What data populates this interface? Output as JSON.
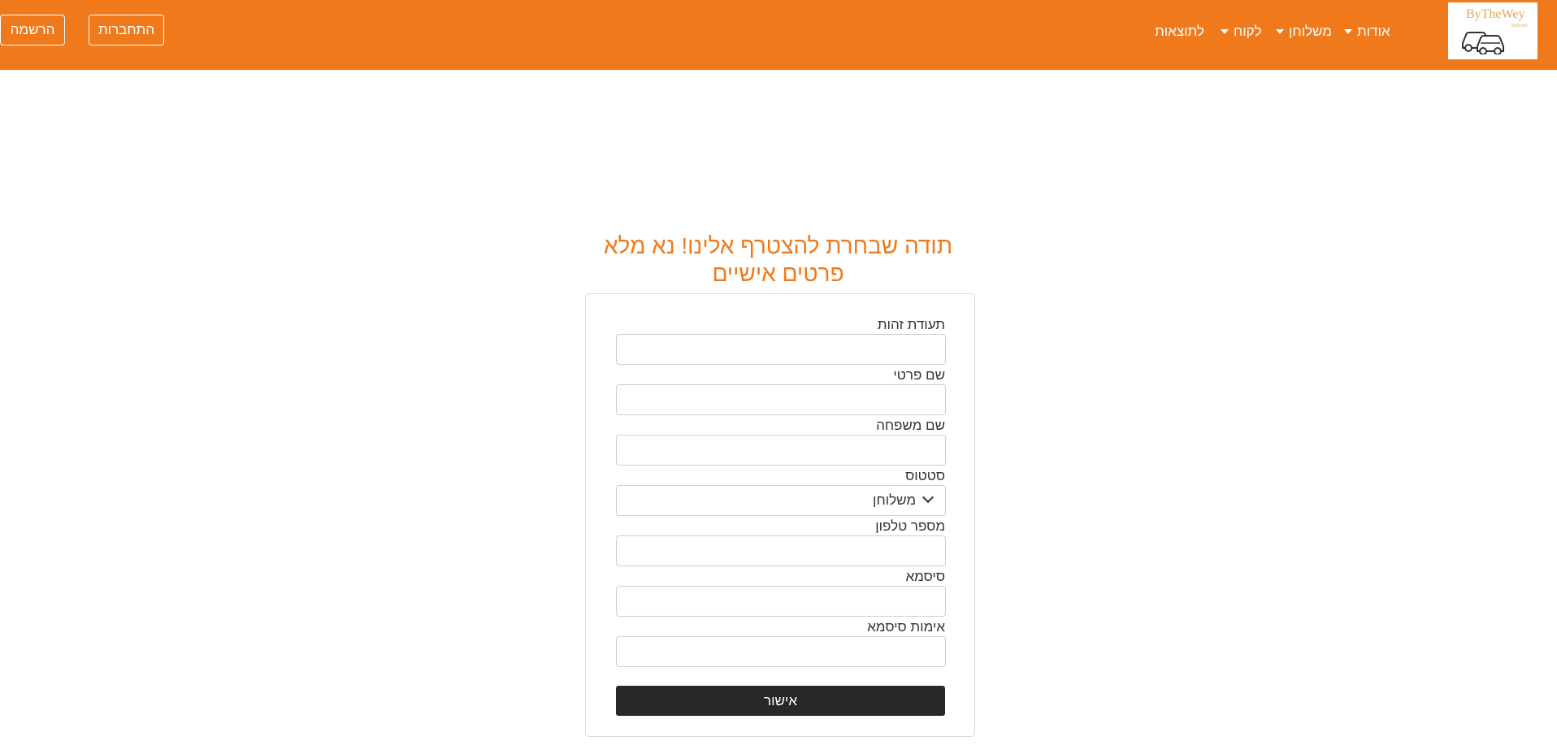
{
  "colors": {
    "brand": "#f07a1b",
    "button_dark": "#282828"
  },
  "logo": {
    "text": "ByTheWey",
    "sub": "Deliveri",
    "icon": "cars-icon"
  },
  "nav": {
    "items": [
      {
        "label": "אודות",
        "dropdown": true
      },
      {
        "label": "משלוחן",
        "dropdown": true
      },
      {
        "label": "לקוח",
        "dropdown": true
      },
      {
        "label": "לתוצאות",
        "dropdown": false
      }
    ],
    "login_label": "התחברות",
    "register_label": "הרשמה"
  },
  "form": {
    "title": "תודה שבחרת להצטרף אלינו! נא מלא פרטים אישיים",
    "fields": {
      "id": {
        "label": "תעודת זהות",
        "value": ""
      },
      "first_name": {
        "label": "שם פרטי",
        "value": ""
      },
      "last_name": {
        "label": "שם משפחה",
        "value": ""
      },
      "status": {
        "label": "סטטוס",
        "selected": "משלוחן"
      },
      "phone": {
        "label": "מספר טלפון",
        "value": ""
      },
      "password": {
        "label": "סיסמא",
        "value": ""
      },
      "confirm_password": {
        "label": "אימות סיסמא",
        "value": ""
      }
    },
    "submit_label": "אישור"
  }
}
